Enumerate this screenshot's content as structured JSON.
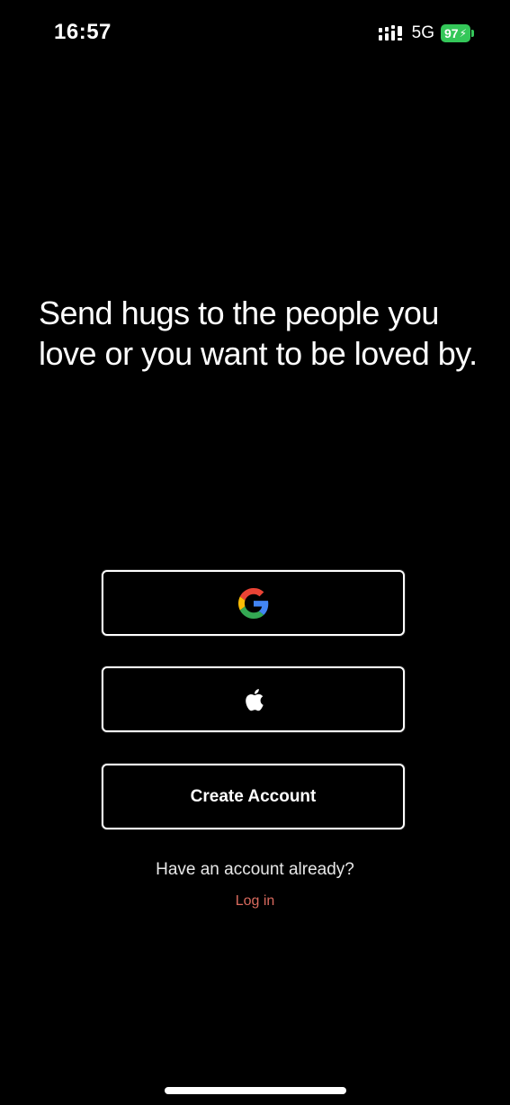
{
  "status_bar": {
    "time": "16:57",
    "signal_icon": "signal-bars-icon",
    "network": "5G",
    "battery_level": "97",
    "battery_icon": "battery-charging-icon",
    "battery_color": "#34c759"
  },
  "main": {
    "tagline": "Send hugs to the people you love or you want to be loved by."
  },
  "auth": {
    "google_icon": "google-icon",
    "apple_icon": "apple-icon",
    "create_account_label": "Create Account",
    "have_account_text": "Have an account already?",
    "login_label": "Log in",
    "login_color": "#d96a5e"
  }
}
